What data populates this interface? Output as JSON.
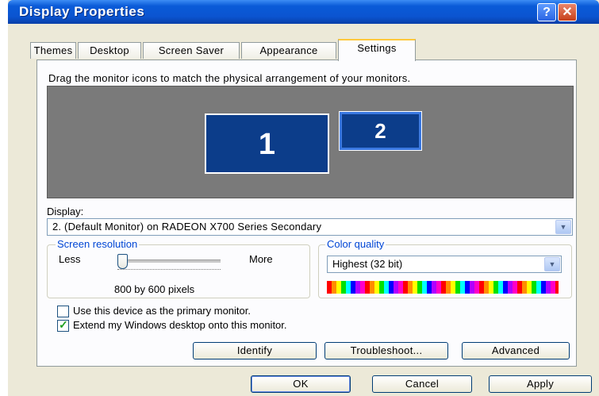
{
  "window": {
    "title": "Display Properties",
    "help_label": "?",
    "close_label": "✕"
  },
  "tabs": [
    {
      "label": "Themes"
    },
    {
      "label": "Desktop"
    },
    {
      "label": "Screen Saver"
    },
    {
      "label": "Appearance"
    },
    {
      "label": "Settings"
    }
  ],
  "active_tab": "Settings",
  "instructions": "Drag the monitor icons to match the physical arrangement of your monitors.",
  "monitors": [
    {
      "label": "1"
    },
    {
      "label": "2",
      "selected": true
    }
  ],
  "display": {
    "label": "Display:",
    "value": "2. (Default Monitor) on RADEON X700 Series Secondary"
  },
  "screen_resolution": {
    "legend": "Screen resolution",
    "less_label": "Less",
    "more_label": "More",
    "value_text": "800 by 600 pixels",
    "slider_position": 0
  },
  "color_quality": {
    "legend": "Color quality",
    "value": "Highest (32 bit)"
  },
  "checkboxes": {
    "primary": {
      "label": "Use this device as the primary monitor.",
      "checked": false
    },
    "extend": {
      "label": "Extend my Windows desktop onto this monitor.",
      "checked": true
    }
  },
  "panel_buttons": {
    "identify": "Identify",
    "troubleshoot": "Troubleshoot...",
    "advanced": "Advanced"
  },
  "dialog_buttons": {
    "ok": "OK",
    "cancel": "Cancel",
    "apply": "Apply"
  },
  "icons": {
    "dropdown": "chevron-down-icon",
    "checkmark": "checkmark-icon"
  },
  "colors": {
    "titlebar": "#0b54d0",
    "monitor": "#0c3d8a",
    "legend": "#0046d5",
    "face": "#ECE9D8"
  }
}
